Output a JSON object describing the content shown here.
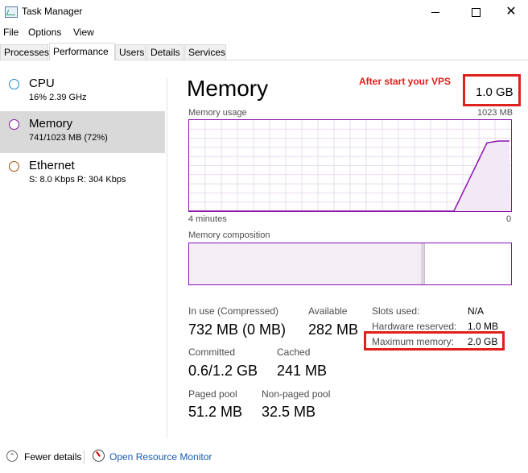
{
  "window": {
    "title": "Task Manager"
  },
  "menu": [
    "File",
    "Options",
    "View"
  ],
  "tabs": [
    "Processes",
    "Performance",
    "Users",
    "Details",
    "Services"
  ],
  "sidebar": [
    {
      "title": "CPU",
      "sub": "16%  2.39 GHz",
      "color": "#1f86c8"
    },
    {
      "title": "Memory",
      "sub": "741/1023 MB (72%)",
      "color": "#8b12ae"
    },
    {
      "title": "Ethernet",
      "sub": "S: 8.0 Kbps  R: 304 Kbps",
      "color": "#a74f01"
    }
  ],
  "main": {
    "title": "Memory",
    "annotation": "After start your VPS",
    "total": "1.0 GB",
    "usage_label": "Memory usage",
    "usage_max": "1023 MB",
    "time_left": "4 minutes",
    "time_right": "0",
    "composition_label": "Memory composition",
    "usage_history_fraction": [
      0,
      0,
      0,
      0,
      0,
      0,
      0,
      0,
      0,
      0.75,
      0.77,
      0.77
    ]
  },
  "composition": {
    "in_use_fraction": 0.72,
    "modified_fraction": 0.01,
    "standby_fraction": 0.23
  },
  "stats": {
    "in_use_label": "In use (Compressed)",
    "in_use_value": "732 MB (0 MB)",
    "available_label": "Available",
    "available_value": "282 MB",
    "committed_label": "Committed",
    "committed_value": "0.6/1.2 GB",
    "cached_label": "Cached",
    "cached_value": "241 MB",
    "paged_label": "Paged pool",
    "paged_value": "51.2 MB",
    "nonpaged_label": "Non-paged pool",
    "nonpaged_value": "32.5 MB"
  },
  "details": {
    "slots_label": "Slots used:",
    "slots_value": "N/A",
    "hw_label": "Hardware reserved:",
    "hw_value": "1.0 MB",
    "max_label": "Maximum memory:",
    "max_value": "2.0 GB"
  },
  "footer": {
    "fewer_details": "Fewer details",
    "open_resource_monitor": "Open Resource Monitor"
  },
  "colors": {
    "accent": "#8b12ae",
    "highlight": "#e0201b",
    "link": "#1a5bb5"
  }
}
